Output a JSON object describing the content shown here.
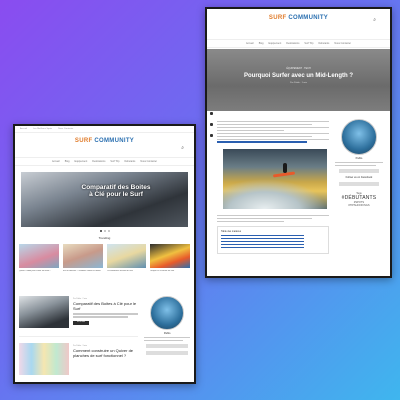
{
  "colors": {
    "logo_orange": "#e07b2a",
    "logo_blue": "#2a6fb0",
    "link_blue": "#2a5fb0",
    "bg_start": "#8a4cf0",
    "bg_end": "#3fb6ee"
  },
  "article_page": {
    "logo": "SURF COMMUNITY",
    "search_icon": "search-icon",
    "nav": [
      "Accueil",
      "Blog",
      "Equipement",
      "Destinations",
      "Surf Trip",
      "Débutants",
      "Nous Contacter"
    ],
    "hero": {
      "category": "ÉQUIPEMENT · TECH",
      "title": "Pourquoi Surfer avec un Mid-Length ?",
      "meta": "Par Pablo · 1 min"
    },
    "intro_link": "Si tu n'as jamais essayé un mid-length, tu passes à côté de ta prochaine vague de plaisir !",
    "toc_title": "Table des matières",
    "sidebar": {
      "author_name": "Pablo",
      "follow_label": "Follow us on Facebook",
      "tags_title": "Tags",
      "tags": [
        "#DÉBUTANTS",
        "#SPOTS",
        "#TIPSHOOKINGS"
      ]
    }
  },
  "home_page": {
    "topbar": [
      "Accueil",
      "Les Meilleurs Spots",
      "Nous Contacter"
    ],
    "logo": "SURF COMMUNITY",
    "nav": [
      "Accueil",
      "Blog",
      "Equipement",
      "Destinations",
      "Surf Trip",
      "Débutants",
      "Nous Contacter"
    ],
    "hero_title": "Comparatif des Boites à Clé pour le Surf",
    "trending_title": "Trending",
    "trending": [
      "Quelle Combi pour surfer en Hiver?",
      "Surf et Bouées : Comment choisir la tienne",
      "Les Meilleures Écoles de Surf",
      "Shaper sa Planche de Surf"
    ],
    "posts": [
      {
        "title": "Comparatif des Boites à Clé pour le Surf",
        "meta": "Par Pablo · 2 min",
        "button": "Lire la suite"
      },
      {
        "title": "Comment construire un Quiver de planches de surf fonctionnel ?",
        "meta": "Par Pablo · 3 min",
        "button": ""
      }
    ],
    "sidebar": {
      "author_name": "Pablo"
    }
  }
}
